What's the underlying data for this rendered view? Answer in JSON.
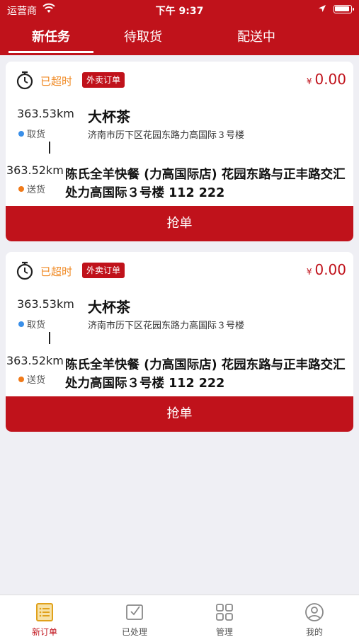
{
  "status_bar": {
    "carrier": "运营商",
    "time": "下午 9:37"
  },
  "tabs": [
    {
      "label": "新任务",
      "active": true
    },
    {
      "label": "待取货",
      "active": false
    },
    {
      "label": "配送中",
      "active": false
    }
  ],
  "orders": [
    {
      "status": "已超时",
      "type_badge": "外卖订单",
      "currency": "¥",
      "price": "0.00",
      "pickup": {
        "distance": "363.53km",
        "label": "取货",
        "title": "大杯茶",
        "address": "济南市历下区花园东路力高国际３号楼"
      },
      "dropoff": {
        "distance": "363.52km",
        "label": "送货",
        "address": "陈氏全羊快餐 (力高国际店) 花园东路与正丰路交汇处力高国际３号楼 112 222"
      },
      "action_label": "抢单"
    },
    {
      "status": "已超时",
      "type_badge": "外卖订单",
      "currency": "¥",
      "price": "0.00",
      "pickup": {
        "distance": "363.53km",
        "label": "取货",
        "title": "大杯茶",
        "address": "济南市历下区花园东路力高国际３号楼"
      },
      "dropoff": {
        "distance": "363.52km",
        "label": "送货",
        "address": "陈氏全羊快餐 (力高国际店) 花园东路与正丰路交汇处力高国际３号楼 112 222"
      },
      "action_label": "抢单"
    }
  ],
  "bottom_nav": [
    {
      "label": "新订单",
      "icon": "order-list-icon",
      "active": true
    },
    {
      "label": "已处理",
      "icon": "processed-icon",
      "active": false
    },
    {
      "label": "管理",
      "icon": "grid-icon",
      "active": false
    },
    {
      "label": "我的",
      "icon": "profile-icon",
      "active": false
    }
  ],
  "colors": {
    "brand_red": "#c0121b",
    "overtime_orange": "#f08a24",
    "pickup_dot": "#3a8fe8",
    "dropoff_dot": "#f07a1a"
  }
}
